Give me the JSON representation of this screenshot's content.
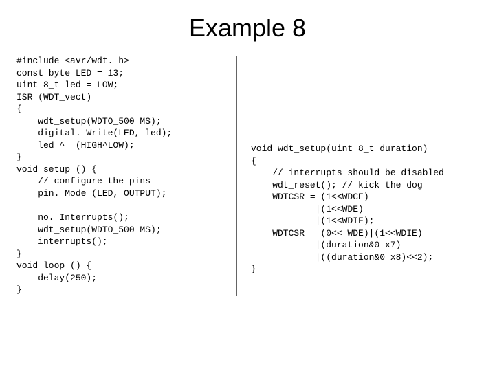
{
  "title": "Example 8",
  "code_left": "#include <avr/wdt. h>\nconst byte LED = 13;\nuint 8_t led = LOW;\nISR (WDT_vect)\n{\n    wdt_setup(WDTO_500 MS);\n    digital. Write(LED, led);\n    led ^= (HIGH^LOW);\n}\nvoid setup () {\n    // configure the pins\n    pin. Mode (LED, OUTPUT);\n\n    no. Interrupts();\n    wdt_setup(WDTO_500 MS);\n    interrupts();\n}\nvoid loop () {\n    delay(250);\n}",
  "code_right": "void wdt_setup(uint 8_t duration)\n{\n    // interrupts should be disabled\n    wdt_reset(); // kick the dog\n    WDTCSR = (1<<WDCE)\n            |(1<<WDE)\n            |(1<<WDIF);\n    WDTCSR = (0<< WDE)|(1<<WDIE)\n            |(duration&0 x7)\n            |((duration&0 x8)<<2);\n}"
}
